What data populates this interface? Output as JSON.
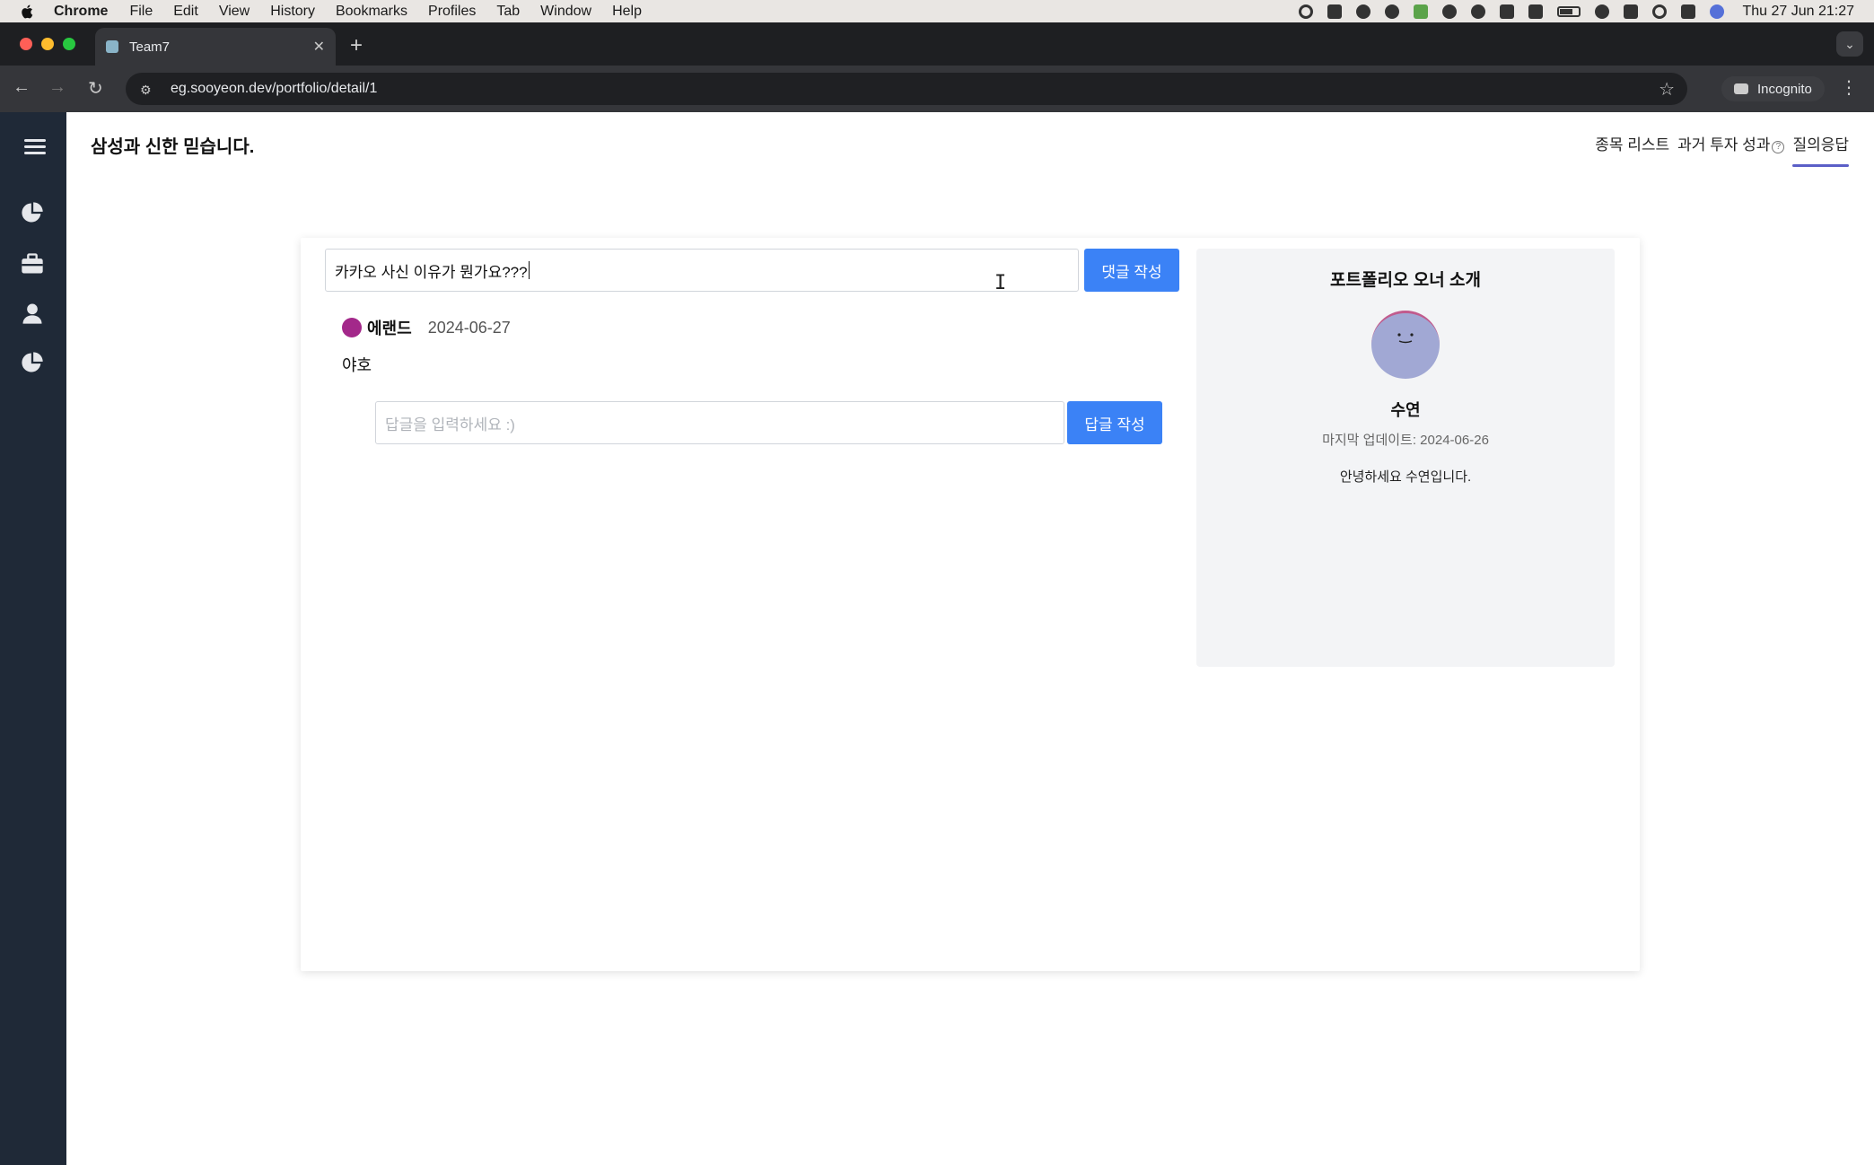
{
  "menubar": {
    "app": "Chrome",
    "items": [
      "File",
      "Edit",
      "View",
      "History",
      "Bookmarks",
      "Profiles",
      "Tab",
      "Window",
      "Help"
    ],
    "clock": "Thu 27 Jun  21:27"
  },
  "browser": {
    "tab_title": "Team7",
    "url": "eg.sooyeon.dev/portfolio/detail/1",
    "incognito_label": "Incognito"
  },
  "header": {
    "title": "삼성과 신한 믿습니다.",
    "nav": [
      {
        "label": "종목 리스트"
      },
      {
        "label": "과거 투자 성과"
      },
      {
        "label": "질의응답"
      }
    ],
    "help_glyph": "?"
  },
  "qna": {
    "comment_input_value": "카카오 사신 이유가 뭔가요???",
    "comment_button": "댓글 작성",
    "comments": [
      {
        "author": "에랜드",
        "date": "2024-06-27",
        "body": "야호"
      }
    ],
    "reply_placeholder": "답글을 입력하세요 :)",
    "reply_button": "답글 작성"
  },
  "owner": {
    "panel_title": "포트폴리오 오너 소개",
    "name": "수연",
    "updated": "마지막 업데이트: 2024-06-26",
    "intro": "안녕하세요 수연입니다."
  },
  "colors": {
    "sidebar": "#1f2937",
    "primary_button": "#3b82f6",
    "active_tab_underline": "#5b5fc7",
    "comment_avatar": "#a3288a",
    "owner_avatar": "#a1a8d4"
  }
}
